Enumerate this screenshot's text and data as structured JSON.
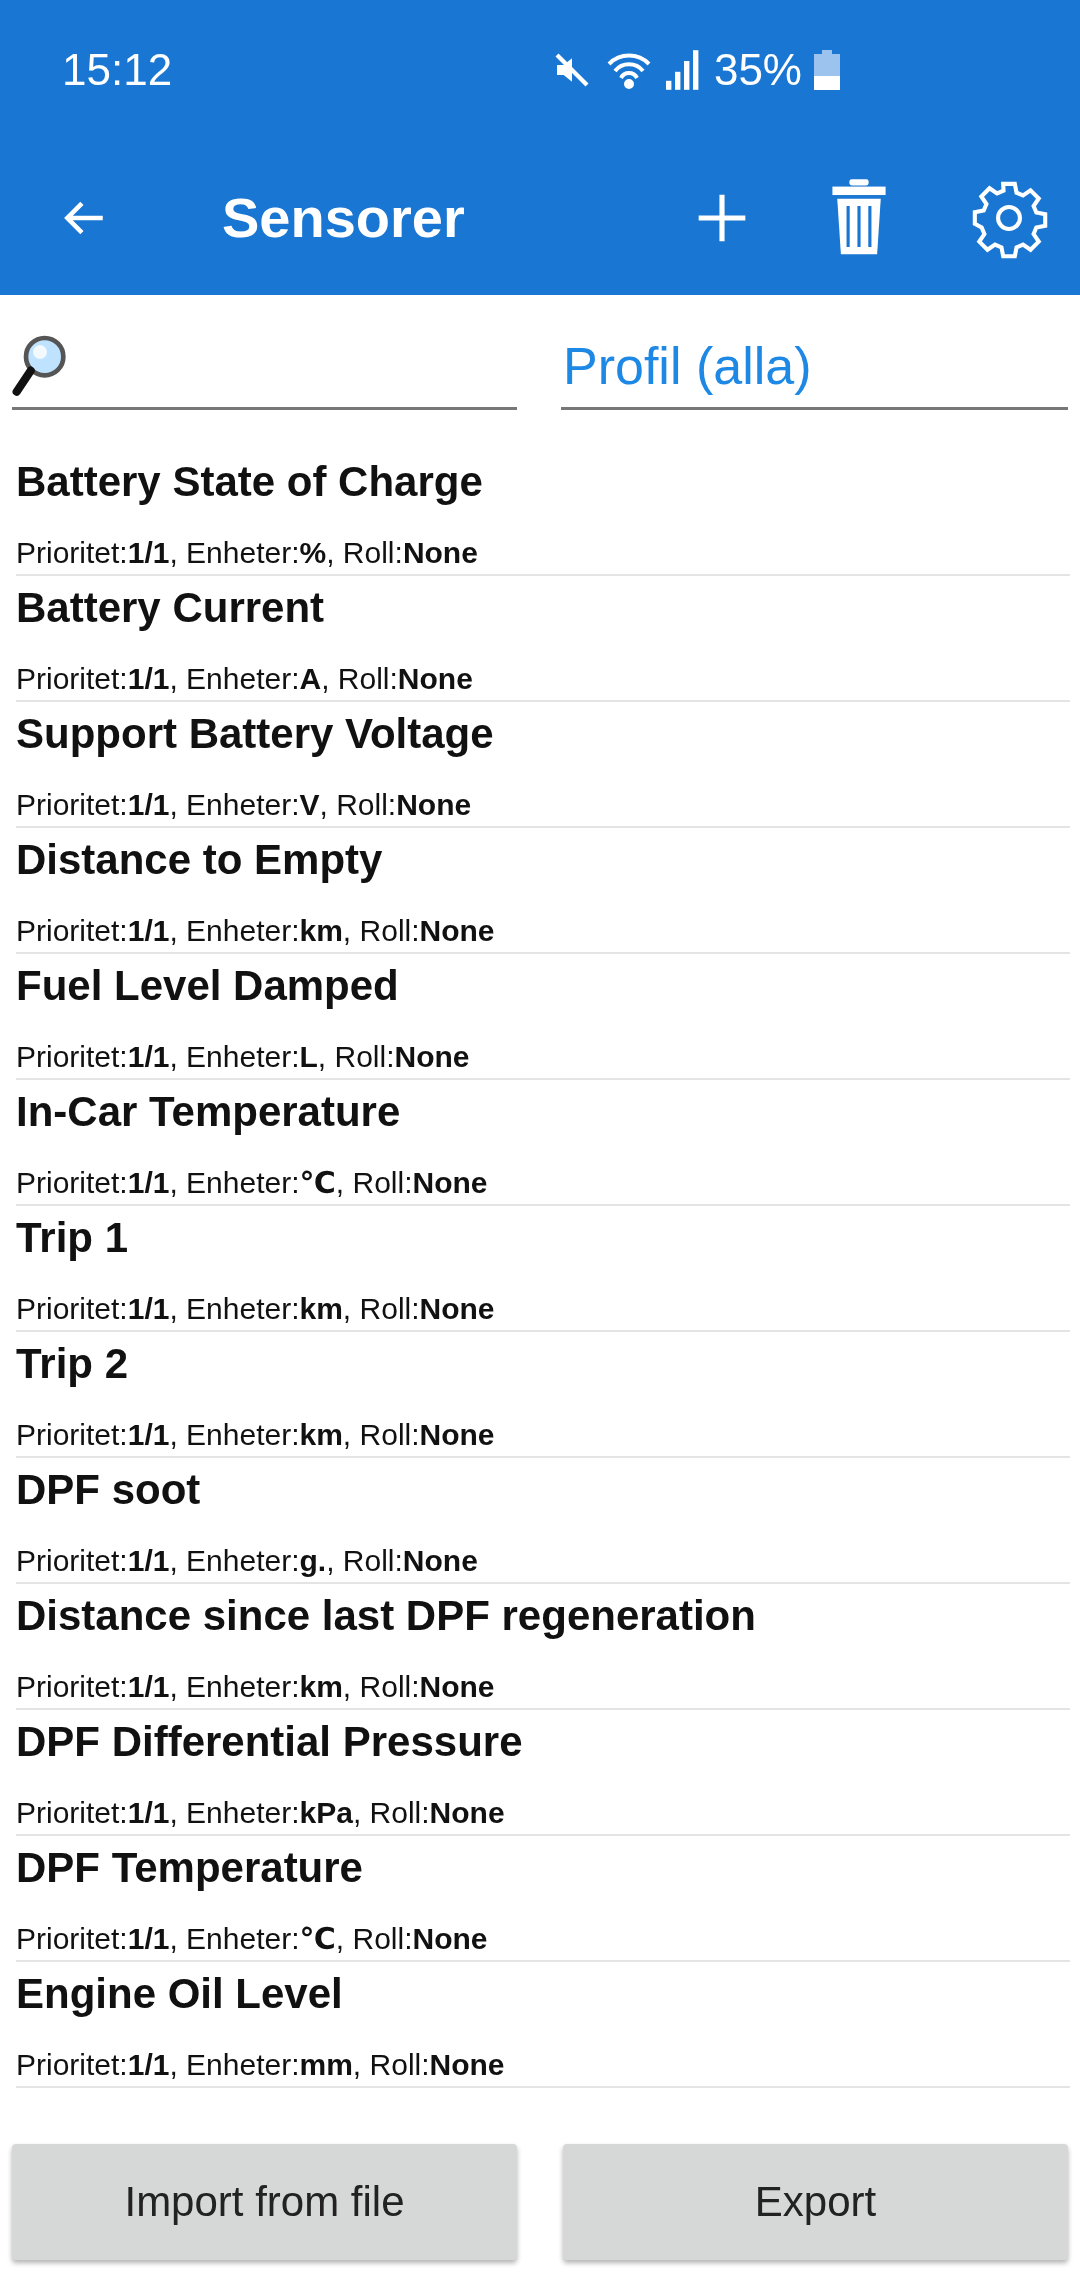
{
  "status_bar": {
    "time": "15:12",
    "battery": "35%"
  },
  "toolbar": {
    "title": "Sensorer"
  },
  "profile": {
    "value": "Profil (alla)"
  },
  "sensors": [
    {
      "name": "Battery State of Charge",
      "details": "Prioritet:**1/1**, Enheter:**%**, Roll:**None**"
    },
    {
      "name": "Battery Current",
      "details": "Prioritet:**1/1**, Enheter:**A**, Roll:**None**"
    },
    {
      "name": "Support Battery Voltage",
      "details": "Prioritet:**1/1**, Enheter:**V**, Roll:**None**"
    },
    {
      "name": "Distance to Empty",
      "details": "Prioritet:**1/1**, Enheter:**km**, Roll:**None**"
    },
    {
      "name": "Fuel Level Damped",
      "details": "Prioritet:**1/1**, Enheter:**L**, Roll:**None**"
    },
    {
      "name": "In-Car Temperature",
      "details": "Prioritet:**1/1**, Enheter:**℃**, Roll:**None**"
    },
    {
      "name": "Trip 1",
      "details": "Prioritet:**1/1**, Enheter:**km**, Roll:**None**"
    },
    {
      "name": "Trip 2",
      "details": "Prioritet:**1/1**, Enheter:**km**, Roll:**None**"
    },
    {
      "name": "DPF soot",
      "details": "Prioritet:**1/1**, Enheter:**g.**, Roll:**None**"
    },
    {
      "name": "Distance since last DPF regeneration",
      "details": "Prioritet:**1/1**, Enheter:**km**, Roll:**None**"
    },
    {
      "name": "DPF Differential Pressure",
      "details": "Prioritet:**1/1**, Enheter:**kPa**, Roll:**None**"
    },
    {
      "name": "DPF Temperature",
      "details": "Prioritet:**1/1**, Enheter:**℃**, Roll:**None**"
    },
    {
      "name": "Engine Oil Level",
      "details": "Prioritet:**1/1**, Enheter:**mm**, Roll:**None**"
    }
  ],
  "buttons": [
    "Import from file",
    "Export"
  ]
}
